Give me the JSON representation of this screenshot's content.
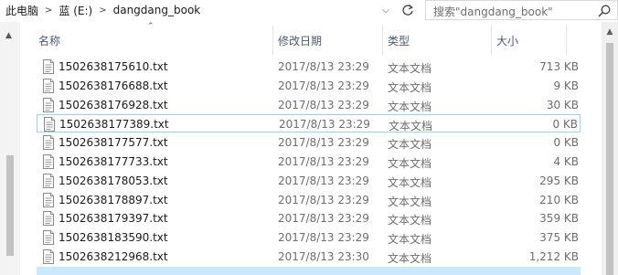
{
  "address": {
    "crumbs": [
      "此电脑",
      "蓝 (E:)",
      "dangdang_book"
    ],
    "separator": ">"
  },
  "search": {
    "placeholder": "搜索\"dangdang_book\""
  },
  "columns": {
    "name": "名称",
    "date": "修改日期",
    "type": "类型",
    "size": "大小"
  },
  "files": [
    {
      "name": "1502638175610.txt",
      "date": "2017/8/13 23:29",
      "type": "文本文档",
      "size": "713 KB"
    },
    {
      "name": "1502638176688.txt",
      "date": "2017/8/13 23:29",
      "type": "文本文档",
      "size": "9 KB"
    },
    {
      "name": "1502638176928.txt",
      "date": "2017/8/13 23:29",
      "type": "文本文档",
      "size": "30 KB"
    },
    {
      "name": "1502638177389.txt",
      "date": "2017/8/13 23:29",
      "type": "文本文档",
      "size": "0 KB",
      "focused": true
    },
    {
      "name": "1502638177577.txt",
      "date": "2017/8/13 23:29",
      "type": "文本文档",
      "size": "0 KB"
    },
    {
      "name": "1502638177733.txt",
      "date": "2017/8/13 23:29",
      "type": "文本文档",
      "size": "4 KB"
    },
    {
      "name": "1502638178053.txt",
      "date": "2017/8/13 23:29",
      "type": "文本文档",
      "size": "295 KB"
    },
    {
      "name": "1502638178897.txt",
      "date": "2017/8/13 23:29",
      "type": "文本文档",
      "size": "210 KB"
    },
    {
      "name": "1502638179397.txt",
      "date": "2017/8/13 23:29",
      "type": "文本文档",
      "size": "359 KB"
    },
    {
      "name": "1502638183590.txt",
      "date": "2017/8/13 23:29",
      "type": "文本文档",
      "size": "375 KB"
    },
    {
      "name": "1502638212968.txt",
      "date": "2017/8/13 23:30",
      "type": "文本文档",
      "size": "1,212 KB"
    }
  ]
}
